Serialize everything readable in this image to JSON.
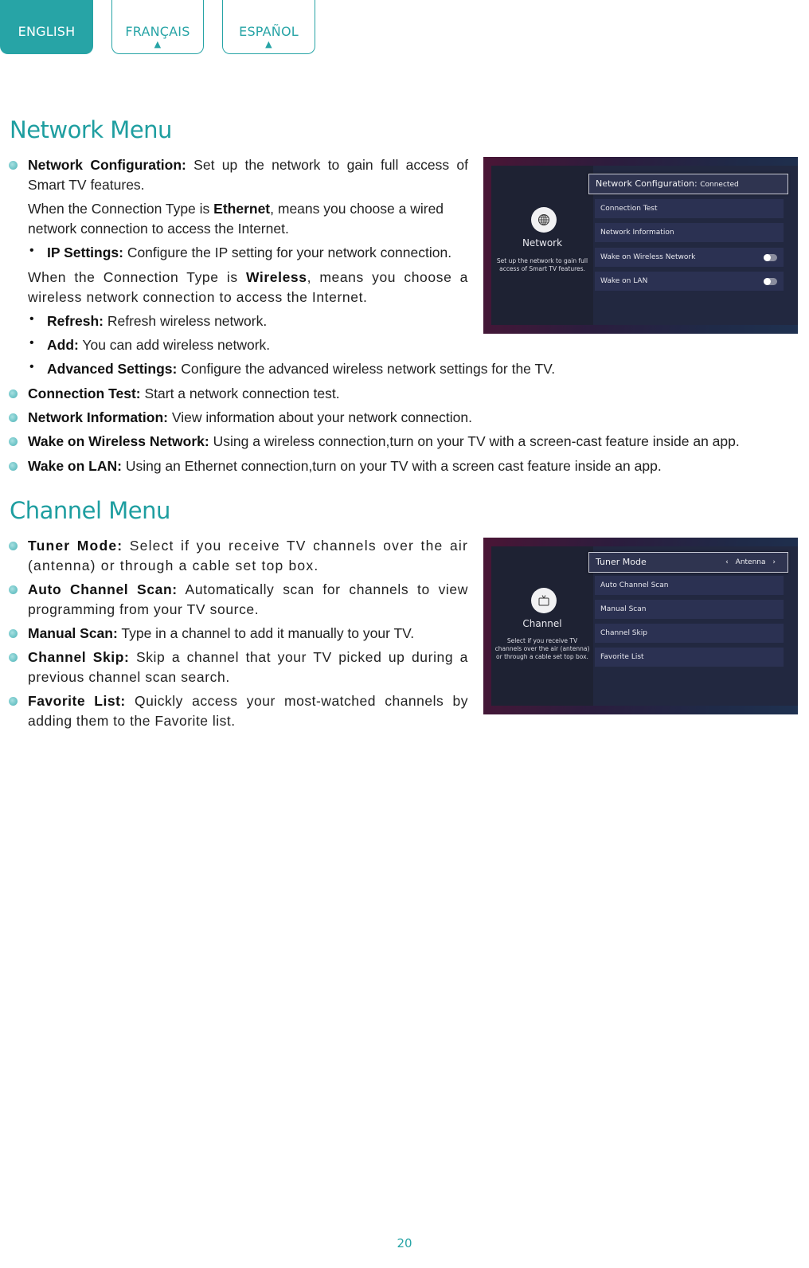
{
  "language_tabs": [
    {
      "label": "ENGLISH",
      "active": true
    },
    {
      "label": "FRANÇAIS",
      "active": false,
      "arrow": "▲"
    },
    {
      "label": "ESPAÑOL",
      "active": false,
      "arrow": "▲"
    }
  ],
  "network_section": {
    "title": "Network Menu",
    "items": [
      {
        "term": "Network Configuration:",
        "text": " Set up the network to gain full access of Smart TV features."
      },
      {
        "para1_pre": "When the Connection Type is ",
        "para1_bold": "Ethernet",
        "para1_post": ", means you choose a wired network connection to access the Internet."
      },
      {
        "term": "IP Settings:",
        "text": " Configure the IP setting for your network connection."
      },
      {
        "para2_pre": "When the Connection Type is ",
        "para2_bold": "Wireless",
        "para2_post": ", means you choose a wireless network connection to access the Internet."
      },
      {
        "term": "Refresh:",
        "text": " Refresh wireless network."
      },
      {
        "term": "Add:",
        "text": " You can add wireless network."
      },
      {
        "term": "Advanced Settings:",
        "text": " Configure the advanced wireless network settings for the TV."
      },
      {
        "term": "Connection Test:",
        "text": " Start a network connection test."
      },
      {
        "term": "Network Information:",
        "text": " View information about your network connection."
      },
      {
        "term": "Wake on Wireless Network:",
        "text": " Using a wireless connection,turn on your TV with a screen-cast feature inside an app."
      },
      {
        "term": "Wake on LAN:",
        "text": " Using an Ethernet connection,turn on your TV with a screen cast feature inside an app."
      }
    ],
    "sub_bullet": "•",
    "screenshot": {
      "icon": "globe-icon",
      "panel_title": "Network",
      "panel_desc": "Set up the network to gain full access of Smart TV features.",
      "selected_row": {
        "label": "Network Configuration:",
        "value": "Connected"
      },
      "rows": [
        {
          "label": "Connection Test",
          "toggle": null
        },
        {
          "label": "Network Information",
          "toggle": null
        },
        {
          "label": "Wake on Wireless Network",
          "toggle": "off"
        },
        {
          "label": "Wake on LAN",
          "toggle": "off"
        }
      ]
    }
  },
  "channel_section": {
    "title": "Channel Menu",
    "items": [
      {
        "term": "Tuner Mode:",
        "text": " Select if you receive TV channels over the air (antenna) or through a cable set top box."
      },
      {
        "term": "Auto Channel Scan:",
        "text": " Automatically scan for channels to view programming from your TV source."
      },
      {
        "term": "Manual Scan:",
        "text": " Type in a channel to add it manually to your TV."
      },
      {
        "term": "Channel Skip:",
        "text": " Skip a channel that your TV picked up during a previous channel scan search."
      },
      {
        "term": "Favorite List:",
        "text": " Quickly access your most-watched channels by adding them to the Favorite list."
      }
    ],
    "screenshot": {
      "icon": "tv-icon",
      "panel_title": "Channel",
      "panel_desc": "Select if you receive TV channels over the air (antenna) or through a cable set top box.",
      "selected_row": {
        "label": "Tuner Mode",
        "value": "Antenna",
        "prev": "‹",
        "next": "›"
      },
      "rows": [
        {
          "label": "Auto Channel Scan"
        },
        {
          "label": "Manual Scan"
        },
        {
          "label": "Channel Skip"
        },
        {
          "label": "Favorite List"
        }
      ]
    }
  },
  "page_number": "20"
}
